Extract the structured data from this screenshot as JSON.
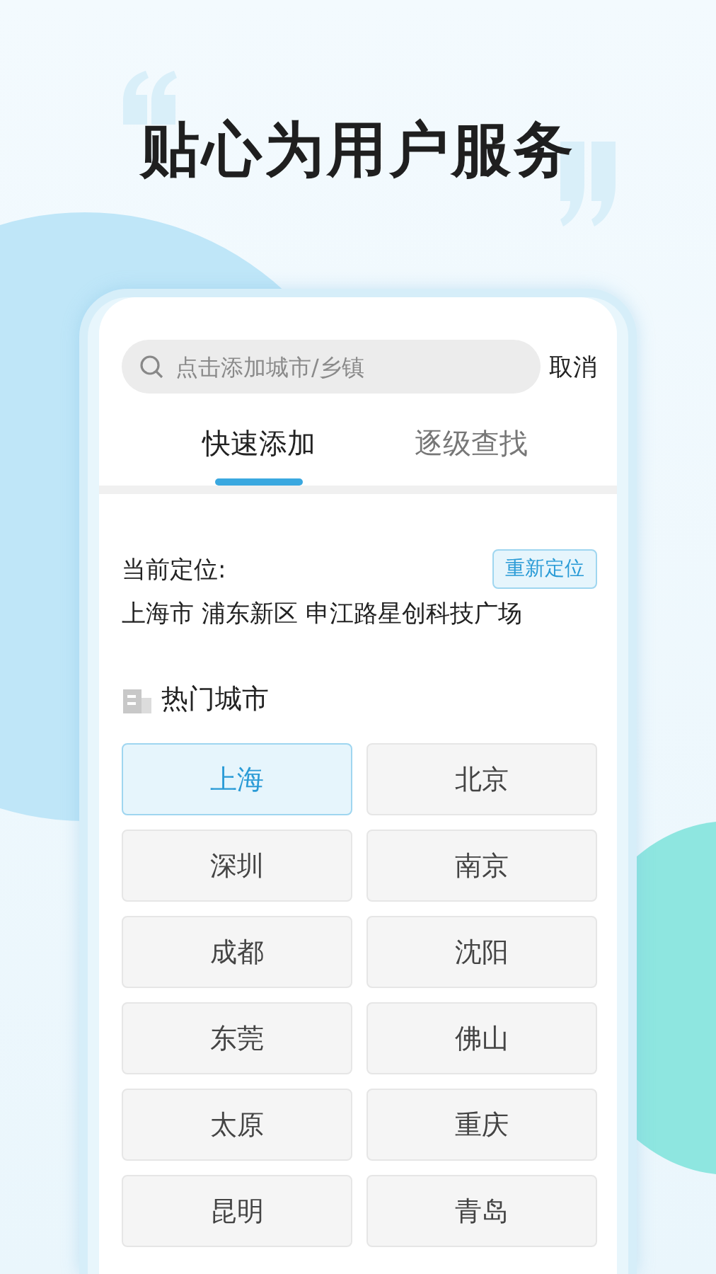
{
  "headline": "贴心为用户服务",
  "search": {
    "placeholder": "点击添加城市/乡镇",
    "cancel": "取消"
  },
  "tabs": [
    {
      "label": "快速添加",
      "selected": true
    },
    {
      "label": "逐级查找",
      "selected": false
    }
  ],
  "location": {
    "label": "当前定位:",
    "relocate": "重新定位",
    "address": "上海市 浦东新区 申江路星创科技广场"
  },
  "hot_cities": {
    "title": "热门城市",
    "cities": [
      {
        "name": "上海",
        "selected": true
      },
      {
        "name": "北京",
        "selected": false
      },
      {
        "name": "深圳",
        "selected": false
      },
      {
        "name": "南京",
        "selected": false
      },
      {
        "name": "成都",
        "selected": false
      },
      {
        "name": "沈阳",
        "selected": false
      },
      {
        "name": "东莞",
        "selected": false
      },
      {
        "name": "佛山",
        "selected": false
      },
      {
        "name": "太原",
        "selected": false
      },
      {
        "name": "重庆",
        "selected": false
      },
      {
        "name": "昆明",
        "selected": false
      },
      {
        "name": "青岛",
        "selected": false
      }
    ]
  }
}
